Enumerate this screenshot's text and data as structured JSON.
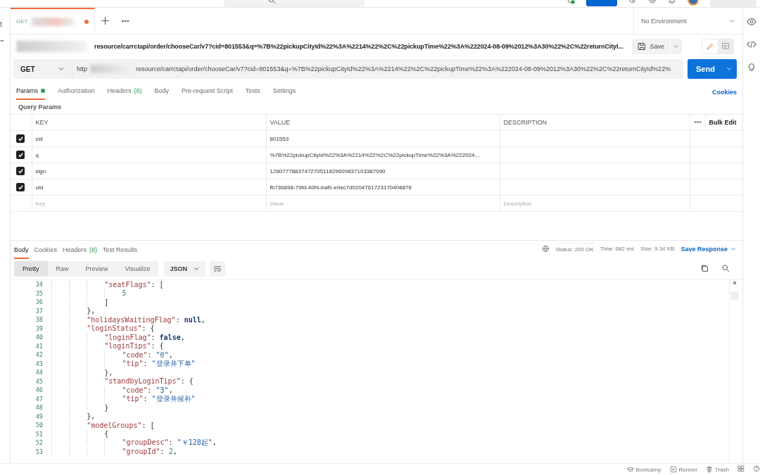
{
  "sidebar_fragment": "t",
  "open_tabs": [
    {
      "method": "GET",
      "unsaved": true,
      "selected": true
    }
  ],
  "environment": "No Environment",
  "request": {
    "title": "resource/carrctapi/order/chooseCar/v7?cid=801553&q=%7B%22pickupCityId%22%3A%2214%22%2C%22pickupTime%22%3A%222024-08-09%2012%3A30%22%2C%22returnCityI...",
    "save": "Save",
    "method": "GET",
    "url_prefix": "http",
    "url": "resource/carrctapi/order/chooseCar/v7?cid=801553&q=%7B%22pickupCityId%22%3A%2214%22%2C%22pickupTime%22%3A%222024-08-09%2012%3A30%22%2C%22returnCityId%22%",
    "send": "Send"
  },
  "request_sections": [
    {
      "label": "Params",
      "dot": true,
      "selected": true
    },
    {
      "label": "Authorization",
      "selected": false
    },
    {
      "label": "Headers",
      "count": "(6)",
      "selected": false
    },
    {
      "label": "Body",
      "selected": false
    },
    {
      "label": "Pre-request Script",
      "selected": false
    },
    {
      "label": "Tests",
      "selected": false
    },
    {
      "label": "Settings",
      "selected": false
    }
  ],
  "cookies": "Cookies",
  "query_params_label": "Query Params",
  "params_table": {
    "columns": [
      "KEY",
      "VALUE",
      "DESCRIPTION"
    ],
    "bulk_edit": "Bulk Edit",
    "rows": [
      {
        "checked": true,
        "key": "cid",
        "value": "801553"
      },
      {
        "checked": true,
        "key": "q",
        "value": "%7B%22pickupCityId%22%3A%2214%22%2C%22pickupTime%22%3A%222024..."
      },
      {
        "checked": true,
        "key": "sign",
        "value": "1280777883747270511829609837103387090"
      },
      {
        "checked": true,
        "key": "uid",
        "value": "fb736898-79fd-40f4-baf0-e0ec7d0204761723170408876"
      }
    ],
    "placeholder": {
      "key": "Key",
      "value": "Value",
      "description": "Description"
    }
  },
  "response_tabs": [
    {
      "label": "Body",
      "selected": true
    },
    {
      "label": "Cookies",
      "selected": false
    },
    {
      "label": "Headers",
      "count": "(8)",
      "selected": false
    },
    {
      "label": "Test Results",
      "selected": false
    }
  ],
  "response_meta": [
    {
      "label": "Status:",
      "value": "200 OK",
      "kind": "status"
    },
    {
      "label": "Time:",
      "value": "682 ms",
      "kind": "plain"
    },
    {
      "label": "Size:",
      "value": "9.34 KB",
      "kind": "plain"
    }
  ],
  "save_response": "Save Response",
  "view_modes": [
    {
      "label": "Pretty",
      "selected": true
    },
    {
      "label": "Raw",
      "selected": false
    },
    {
      "label": "Preview",
      "selected": false
    },
    {
      "label": "Visualize",
      "selected": false
    }
  ],
  "format": "JSON",
  "code_lines": [
    {
      "num": "34",
      "text": "            \"seatFlags\": ["
    },
    {
      "num": "35",
      "text": "                5"
    },
    {
      "num": "36",
      "text": "            ]"
    },
    {
      "num": "37",
      "text": "        },"
    },
    {
      "num": "38",
      "text": "        \"holidaysWaitingFlag\": null,"
    },
    {
      "num": "39",
      "text": "        \"loginStatus\": {"
    },
    {
      "num": "40",
      "text": "            \"loginFlag\": false,"
    },
    {
      "num": "41",
      "text": "            \"loginTips\": {"
    },
    {
      "num": "42",
      "text": "                \"code\": \"0\","
    },
    {
      "num": "43",
      "text": "                \"tip\": \"登录并下单\""
    },
    {
      "num": "44",
      "text": "            },"
    },
    {
      "num": "45",
      "text": "            \"standbyLoginTips\": {"
    },
    {
      "num": "46",
      "text": "                \"code\": \"3\","
    },
    {
      "num": "47",
      "text": "                \"tip\": \"登录并候补\""
    },
    {
      "num": "48",
      "text": "            }"
    },
    {
      "num": "49",
      "text": "        },"
    },
    {
      "num": "50",
      "text": "        \"modelGroups\": ["
    },
    {
      "num": "51",
      "text": "            {"
    },
    {
      "num": "52",
      "text": "                \"groupDesc\": \"￥128起\","
    },
    {
      "num": "53",
      "text": "                \"groupId\": 2,"
    }
  ],
  "status_bar": [
    {
      "label": "Bootcamp",
      "kind": "bootcamp"
    },
    {
      "label": "Runner",
      "kind": "runner"
    },
    {
      "label": "Trash",
      "kind": "trash"
    }
  ]
}
